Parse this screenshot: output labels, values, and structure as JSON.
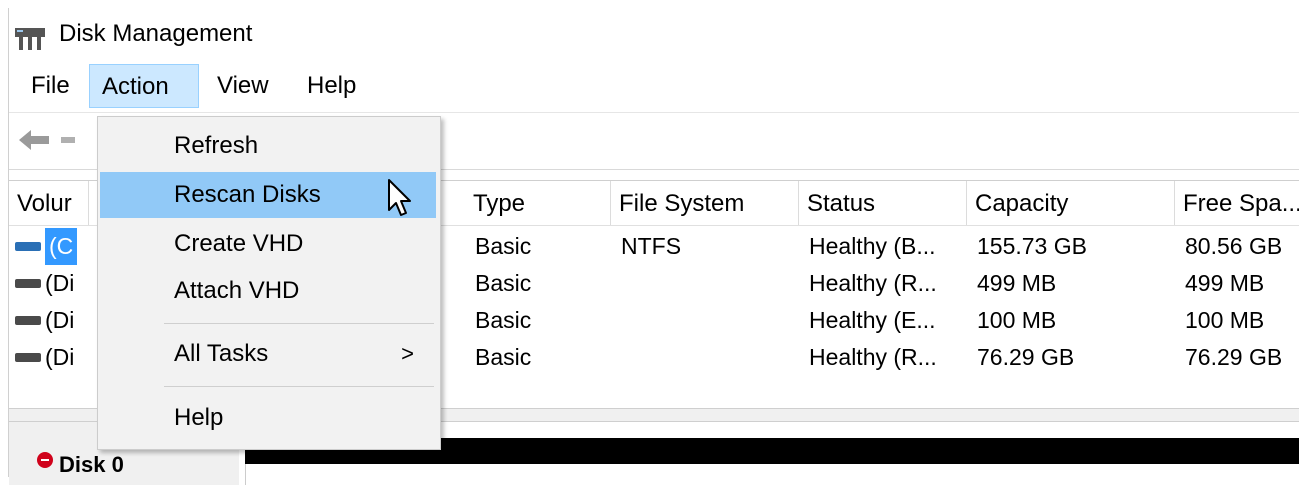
{
  "window": {
    "title": "Disk Management"
  },
  "menu": {
    "items": [
      "File",
      "Action",
      "View",
      "Help"
    ],
    "active": "Action"
  },
  "action_menu": {
    "items": [
      {
        "label": "Refresh"
      },
      {
        "label": "Rescan Disks"
      },
      {
        "label": "Create VHD"
      },
      {
        "label": "Attach VHD"
      },
      {
        "label": "All Tasks",
        "arrow": ">"
      },
      {
        "label": "Help"
      }
    ],
    "hovered": "Rescan Disks"
  },
  "table": {
    "headers": [
      "Volur",
      "Type",
      "File System",
      "Status",
      "Capacity",
      "Free Spa..."
    ],
    "rows": [
      {
        "volume": "(C",
        "type": "Basic",
        "fs": "NTFS",
        "status": "Healthy (B...",
        "capacity": "155.73 GB",
        "free": "80.56 GB"
      },
      {
        "volume": "(Di",
        "type": "Basic",
        "fs": "",
        "status": "Healthy (R...",
        "capacity": "499 MB",
        "free": "499 MB"
      },
      {
        "volume": "(Di",
        "type": "Basic",
        "fs": "",
        "status": "Healthy (E...",
        "capacity": "100 MB",
        "free": "100 MB"
      },
      {
        "volume": "(Di",
        "type": "Basic",
        "fs": "",
        "status": "Healthy (R...",
        "capacity": "76.29 GB",
        "free": "76.29 GB"
      }
    ]
  },
  "disks": [
    {
      "name": "Disk 0"
    }
  ],
  "colors": {
    "menu_active": "#cce8ff",
    "menu_hover": "#91c9f7",
    "selection": "#3399ff",
    "disk_alert": "#d0021b"
  }
}
